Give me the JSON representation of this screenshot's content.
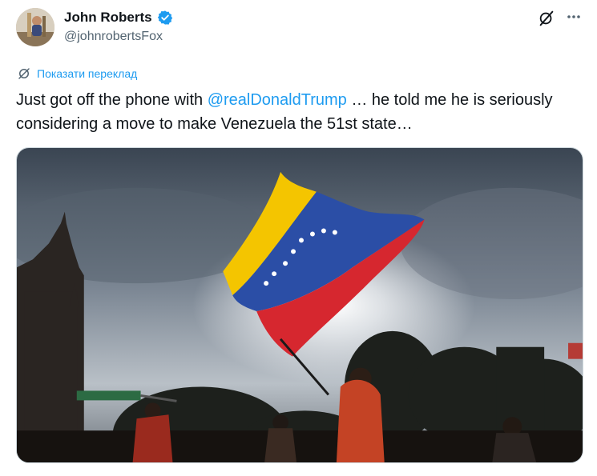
{
  "author": {
    "name": "John Roberts",
    "handle": "@johnrobertsFox",
    "verified": true,
    "verified_color": "#1d9bf0"
  },
  "header_icons": [
    "grok-icon",
    "more-options-icon"
  ],
  "translate": {
    "label": "Показати переклад",
    "icon": "translate-icon"
  },
  "tweet": {
    "text_before": "Just got off the phone with ",
    "mention": "@realDonaldTrump",
    "text_after": " … he told me he is seriously considering a move to make Venezuela the 51st state…"
  },
  "colors": {
    "link": "#1d9bf0",
    "secondary_text": "#536471",
    "flag_yellow": "#f4c500",
    "flag_blue": "#2b4ea6",
    "flag_red": "#d6272f"
  }
}
